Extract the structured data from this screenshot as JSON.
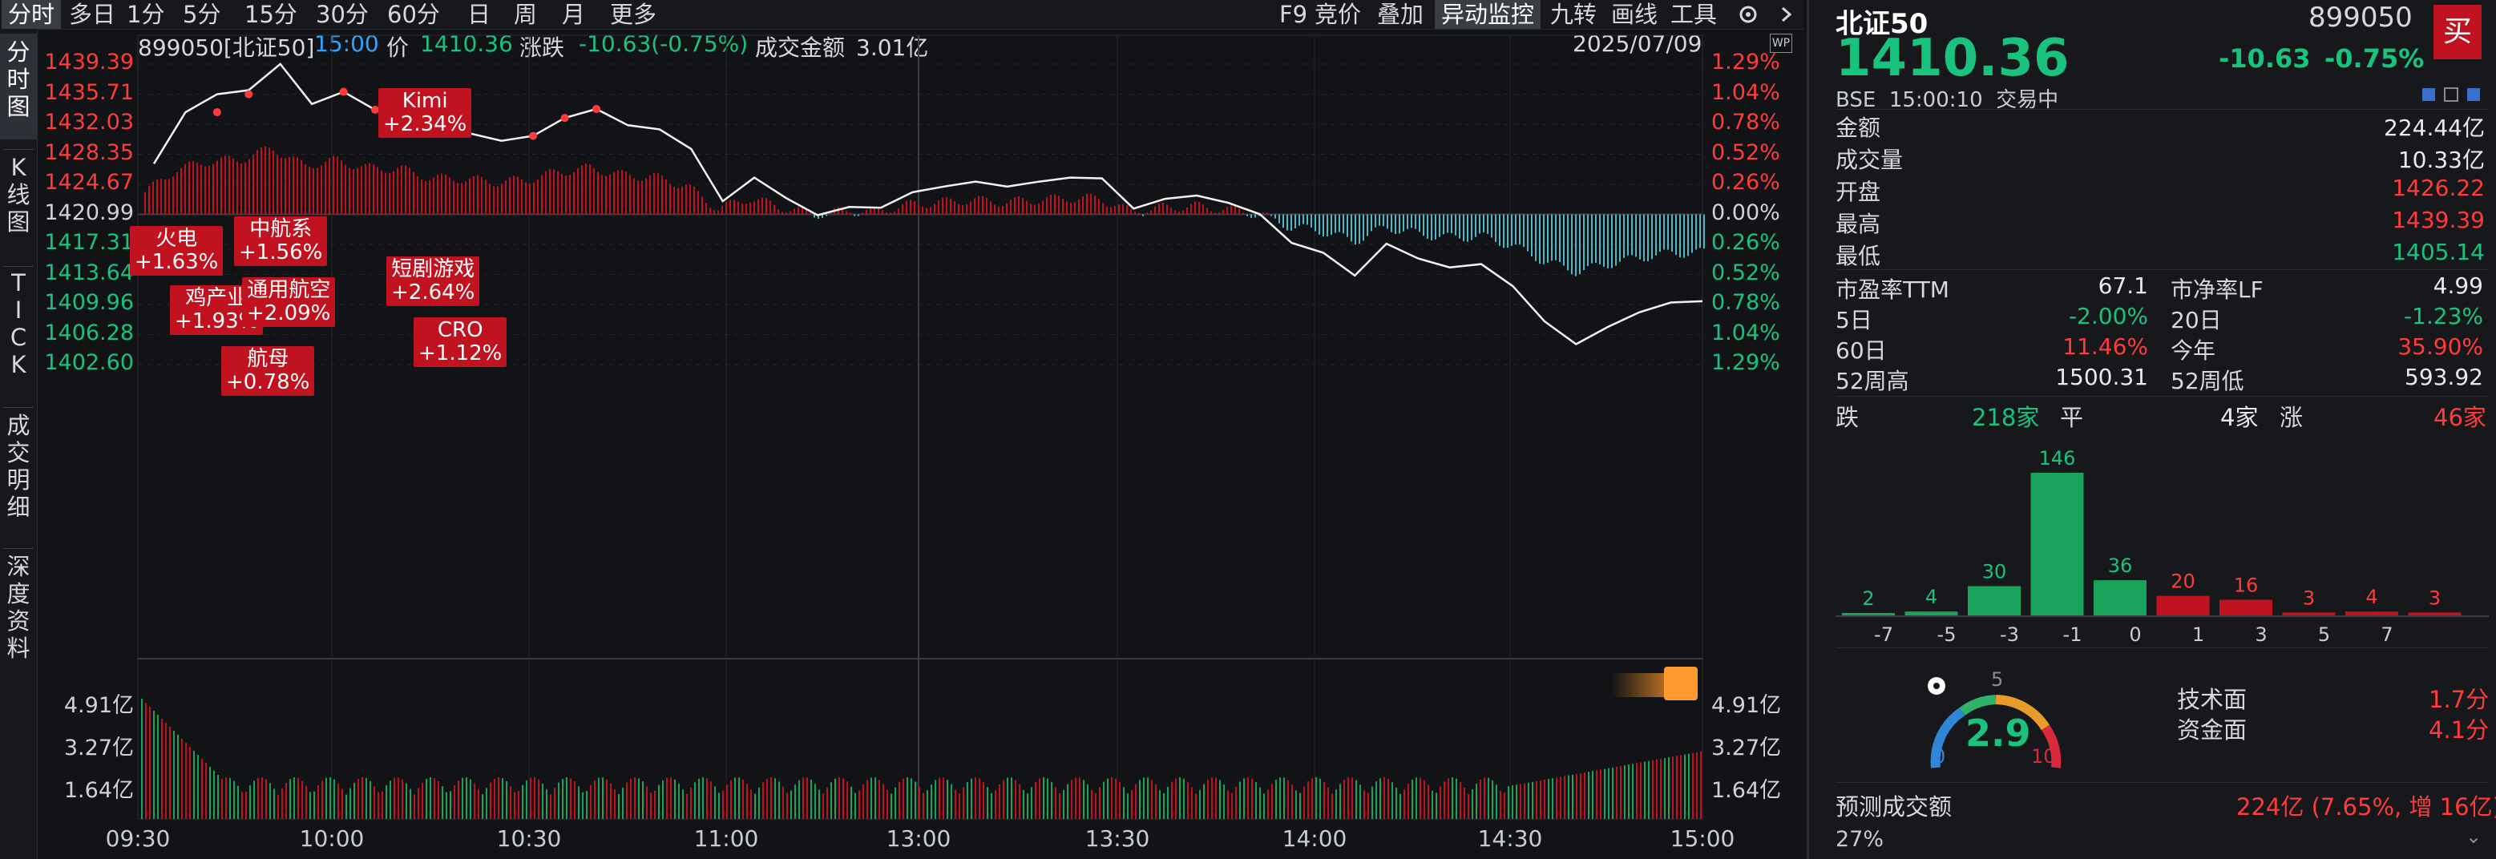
{
  "toolbar": {
    "left_tabs": [
      "分时",
      "多日",
      "1分",
      "5分",
      "15分",
      "30分",
      "60分",
      "日",
      "周",
      "月",
      "更多"
    ],
    "right_items": [
      "F9",
      "竞价",
      "叠加",
      "异动监控",
      "九转",
      "画线",
      "工具"
    ],
    "active_right": "异动监控"
  },
  "vertical_tabs": [
    "分时图",
    "K线图",
    "TICK",
    "成交明细",
    "深度资料"
  ],
  "chart_header": {
    "code_name": "899050[北证50]",
    "time": "15:00",
    "price_label": "价",
    "price": "1410.36",
    "change_label": "涨跌",
    "change": "-10.63(-0.75%)",
    "turnover_label": "成交金额",
    "turnover": "3.01亿",
    "date": "2025/07/09",
    "wp_badge": "WP"
  },
  "price_axis_left": [
    "1439.39",
    "1435.71",
    "1432.03",
    "1428.35",
    "1424.67",
    "1420.99",
    "1417.31",
    "1413.64",
    "1409.96",
    "1406.28",
    "1402.60"
  ],
  "price_axis_right": [
    "1.29%",
    "1.04%",
    "0.78%",
    "0.52%",
    "0.26%",
    "0.00%",
    "0.26%",
    "0.52%",
    "0.78%",
    "1.04%",
    "1.29%"
  ],
  "volume_axis": [
    "4.91亿",
    "3.27亿",
    "1.64亿"
  ],
  "time_axis": [
    "09:30",
    "10:00",
    "10:30",
    "11:00",
    "13:00",
    "13:30",
    "14:00",
    "14:30",
    "15:00"
  ],
  "annotations": [
    {
      "name": "Kimi",
      "change": "+2.34%"
    },
    {
      "name": "火电",
      "change": "+1.63%"
    },
    {
      "name": "中航系",
      "change": "+1.56%"
    },
    {
      "name": "鸡产业",
      "change": "+1.93%"
    },
    {
      "name": "通用航空",
      "change": "+2.09%"
    },
    {
      "name": "短剧游戏",
      "change": "+2.64%"
    },
    {
      "name": "航母",
      "change": "+0.78%"
    },
    {
      "name": "CRO",
      "change": "+1.12%"
    }
  ],
  "chart_data": {
    "type": "line",
    "title": "",
    "x_labels": [
      "09:30",
      "10:00",
      "10:30",
      "11:00",
      "13:00",
      "13:30",
      "14:00",
      "14:30",
      "15:00"
    ],
    "ylim": [
      1402.6,
      1439.39
    ],
    "prev_close": 1420.99,
    "price_series": [
      1427.2,
      1433.5,
      1435.7,
      1436.2,
      1439.4,
      1434.5,
      1436.0,
      1433.8,
      1433.7,
      1431.0,
      1430.9,
      1430.0,
      1430.6,
      1432.8,
      1433.9,
      1431.9,
      1431.4,
      1429.0,
      1422.6,
      1425.5,
      1423.0,
      1420.9,
      1421.9,
      1421.8,
      1423.7,
      1424.4,
      1425.0,
      1424.4,
      1425.0,
      1425.5,
      1425.4,
      1421.7,
      1422.9,
      1423.3,
      1422.4,
      1421.0,
      1417.5,
      1416.3,
      1413.5,
      1417.4,
      1415.6,
      1414.5,
      1414.9,
      1412.2,
      1407.9,
      1405.1,
      1407.2,
      1409.0,
      1410.2,
      1410.36
    ],
    "volume_axis_labels": [
      "4.91亿",
      "3.27亿",
      "1.64亿"
    ]
  },
  "quote_panel": {
    "name": "北证50",
    "code": "899050",
    "price": "1410.36",
    "change": "-10.63",
    "change_pct": "-0.75%",
    "buy_label": "买",
    "market_info": "BSE  15:00:10  交易中",
    "rows": [
      {
        "k": "金额",
        "v": "224.44亿",
        "color": "white"
      },
      {
        "k": "成交量",
        "v": "10.33亿",
        "color": "white"
      },
      {
        "k": "开盘",
        "v": "1426.22",
        "color": "red"
      },
      {
        "k": "最高",
        "v": "1439.39",
        "color": "red"
      },
      {
        "k": "最低",
        "v": "1405.14",
        "color": "green"
      }
    ],
    "pairs": [
      {
        "k1": "市盈率TTM",
        "v1": "67.1",
        "c1": "white",
        "k2": "市净率LF",
        "v2": "4.99",
        "c2": "white"
      },
      {
        "k1": "5日",
        "v1": "-2.00%",
        "c1": "green",
        "k2": "20日",
        "v2": "-1.23%",
        "c2": "green"
      },
      {
        "k1": "60日",
        "v1": "11.46%",
        "c1": "red",
        "k2": "今年",
        "v2": "35.90%",
        "c2": "red"
      },
      {
        "k1": "52周高",
        "v1": "1500.31",
        "c1": "white",
        "k2": "52周低",
        "v2": "593.92",
        "c2": "white"
      }
    ],
    "breadth": {
      "down_label": "跌",
      "down": "218家",
      "flat_label": "平",
      "flat": "4家",
      "up_label": "涨",
      "up": "46家"
    }
  },
  "distribution": {
    "counts": [
      2,
      4,
      30,
      146,
      36,
      20,
      16,
      3,
      4,
      3
    ],
    "colors": [
      "#19a35a",
      "#19a35a",
      "#19a35a",
      "#19a35a",
      "#19a35a",
      "#c0131f",
      "#c0131f",
      "#c0131f",
      "#c0131f",
      "#c0131f"
    ],
    "axis": [
      "-7",
      "-5",
      "-3",
      "-1",
      "0",
      "1",
      "3",
      "5",
      "7"
    ]
  },
  "gauge": {
    "value": "2.9",
    "min": "0",
    "mid": "5",
    "max": "10",
    "tech_label": "技术面",
    "tech": "1.7分",
    "fund_label": "资金面",
    "fund": "4.1分"
  },
  "forecast": {
    "label": "预测成交额",
    "value": "224亿 (7.65%, 增 16亿)",
    "pct": "27%"
  }
}
